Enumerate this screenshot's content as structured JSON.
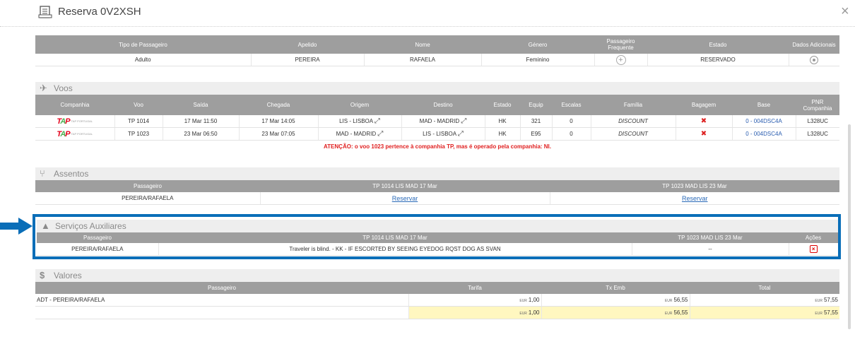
{
  "window": {
    "title": "Reserva 0V2XSH",
    "close": "×"
  },
  "passengers": {
    "headers": [
      "Tipo de Passageiro",
      "Apelido",
      "Nome",
      "Género",
      "Passageiro Frequente",
      "Estado",
      "Dados Adicionais"
    ],
    "rows": [
      {
        "tipo": "Adulto",
        "apelido": "PEREIRA",
        "nome": "RAFAELA",
        "genero": "Feminino",
        "frequente": "+",
        "estado": "RESERVADO"
      }
    ]
  },
  "voos": {
    "title": "Voos",
    "headers": [
      "Companhia",
      "Voo",
      "Saída",
      "Chegada",
      "Origem",
      "Destino",
      "Estado",
      "Equip",
      "Escalas",
      "Família",
      "Bagagem",
      "Base",
      "PNR Companhia"
    ],
    "airline_logo": "TAP PORTUGAL",
    "rows": [
      {
        "voo": "TP 1014",
        "saida": "17 Mar 11:50",
        "chegada": "17 Mar 14:05",
        "origem": "LIS - LISBOA",
        "destino": "MAD - MADRID",
        "estado": "HK",
        "equip": "321",
        "escalas": "0",
        "familia": "DISCOUNT",
        "base": "0 - 004DSC4A",
        "pnr": "L328UC"
      },
      {
        "voo": "TP 1023",
        "saida": "23 Mar 06:50",
        "chegada": "23 Mar 07:05",
        "origem": "MAD - MADRID",
        "destino": "LIS - LISBOA",
        "estado": "HK",
        "equip": "E95",
        "escalas": "0",
        "familia": "DISCOUNT",
        "base": "0 - 004DSC4A",
        "pnr": "L328UC"
      }
    ],
    "warning": "ATENÇÃO: o voo 1023 pertence à companhia TP, mas é operado pela companhia: NI."
  },
  "assentos": {
    "title": "Assentos",
    "headers": [
      "Passageiro",
      "TP 1014 LIS MAD 17 Mar",
      "TP 1023 MAD LIS 23 Mar"
    ],
    "rows": [
      {
        "passageiro": "PEREIRA/RAFAELA",
        "seg1": "Reservar",
        "seg2": "Reservar"
      }
    ]
  },
  "servicos": {
    "title": "Serviços Auxiliares",
    "headers": [
      "Passageiro",
      "TP 1014 LIS MAD 17 Mar",
      "TP 1023 MAD LIS 23 Mar",
      "Ações"
    ],
    "rows": [
      {
        "passageiro": "PEREIRA/RAFAELA",
        "seg1": "Traveler is blind. - KK - IF ESCORTED BY SEEING EYEDOG RQST DOG AS SVAN",
        "seg2": "--",
        "acao": "×"
      }
    ]
  },
  "valores": {
    "title": "Valores",
    "headers": [
      "Passageiro",
      "Tarifa",
      "Tx Emb",
      "Total"
    ],
    "currency": "EUR",
    "rows": [
      {
        "passageiro": "ADT - PEREIRA/RAFAELA",
        "tarifa": "1,00",
        "tx": "56,55",
        "total": "57,55"
      }
    ],
    "totals": {
      "passageiro": "",
      "tarifa": "1,00",
      "tx": "56,55",
      "total": "57,55"
    }
  },
  "colors": {
    "header_bg": "#9e9e9e",
    "highlight": "#0a6eb8",
    "total_row": "#fff7c0",
    "warning": "#e02020"
  }
}
